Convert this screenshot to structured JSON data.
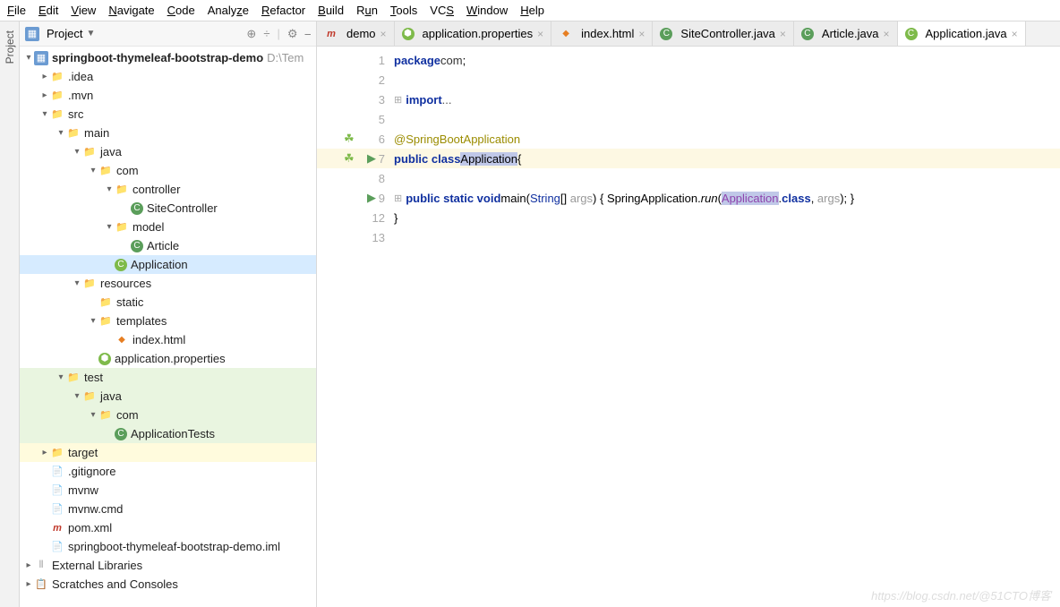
{
  "menu": [
    "File",
    "Edit",
    "View",
    "Navigate",
    "Code",
    "Analyze",
    "Refactor",
    "Build",
    "Run",
    "Tools",
    "VCS",
    "Window",
    "Help"
  ],
  "pane": {
    "title": "Project"
  },
  "tree": {
    "root": {
      "name": "springboot-thymeleaf-bootstrap-demo",
      "path": "D:\\Tem"
    },
    "idea": ".idea",
    "mvn": ".mvn",
    "src": "src",
    "main": "main",
    "java": "java",
    "com": "com",
    "controller": "controller",
    "sitecontroller": "SiteController",
    "model": "model",
    "article": "Article",
    "application": "Application",
    "resources": "resources",
    "static": "static",
    "templates": "templates",
    "indexhtml": "index.html",
    "appprops": "application.properties",
    "test": "test",
    "testjava": "java",
    "testcom": "com",
    "apptests": "ApplicationTests",
    "target": "target",
    "gitignore": ".gitignore",
    "mvnw": "mvnw",
    "mvnwcmd": "mvnw.cmd",
    "pom": "pom.xml",
    "iml": "springboot-thymeleaf-bootstrap-demo.iml",
    "extlib": "External Libraries",
    "scratches": "Scratches and Consoles"
  },
  "tabs": [
    {
      "label": "demo",
      "icon": "mvn"
    },
    {
      "label": "application.properties",
      "icon": "spring"
    },
    {
      "label": "index.html",
      "icon": "html"
    },
    {
      "label": "SiteController.java",
      "icon": "class"
    },
    {
      "label": "Article.java",
      "icon": "class"
    },
    {
      "label": "Application.java",
      "icon": "spring",
      "active": true
    }
  ],
  "code": {
    "l1a": "package",
    "l1b": "com",
    "l1c": ";",
    "l3a": "import",
    "l3b": "...",
    "l6": "@SpringBootApplication",
    "l7a": "public class",
    "l7b": "Application",
    "l7c": "{",
    "l9a": "public static void",
    "l9b": "main",
    "l9c": "(",
    "l9d": "String",
    "l9e": "[] ",
    "l9f": "args",
    "l9g": ") { ",
    "l9h": "SpringApplication",
    "l9i": ".",
    "l9j": "run",
    "l9k": "(",
    "l9l": "Application",
    "l9m": ".",
    "l9n": "class",
    "l9o": ", ",
    "l9p": "args",
    "l9q": "); }",
    "l12": "}"
  },
  "watermark": "https://blog.csdn.net/@51CTO博客"
}
